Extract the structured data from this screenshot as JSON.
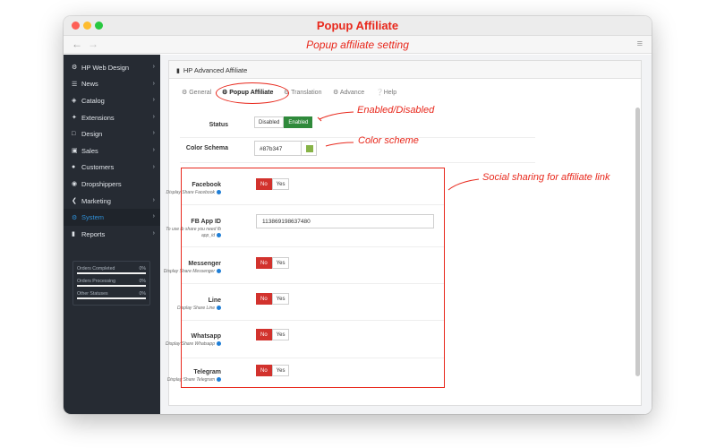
{
  "window": {
    "title": "Popup Affiliate",
    "subtitle": "Popup affiliate setting"
  },
  "browser": {
    "back_icon": "arrow-left-icon",
    "forward_icon": "arrow-right-icon",
    "menu_icon": "hamburger-icon"
  },
  "sidebar": {
    "items": [
      {
        "icon": "gears-icon",
        "label": "HP Web Design",
        "has_children": true
      },
      {
        "icon": "newspaper-icon",
        "label": "News",
        "has_children": true
      },
      {
        "icon": "tag-icon",
        "label": "Catalog",
        "has_children": true
      },
      {
        "icon": "puzzle-icon",
        "label": "Extensions",
        "has_children": true
      },
      {
        "icon": "monitor-icon",
        "label": "Design",
        "has_children": true
      },
      {
        "icon": "cart-icon",
        "label": "Sales",
        "has_children": true
      },
      {
        "icon": "user-icon",
        "label": "Customers",
        "has_children": true
      },
      {
        "icon": "users-icon",
        "label": "Dropshippers",
        "has_children": false
      },
      {
        "icon": "share-icon",
        "label": "Marketing",
        "has_children": true
      },
      {
        "icon": "gear-icon",
        "label": "System",
        "has_children": true,
        "active": true
      },
      {
        "icon": "bar-chart-icon",
        "label": "Reports",
        "has_children": true
      }
    ],
    "stats": [
      {
        "label": "Orders Completed",
        "percent": "0%"
      },
      {
        "label": "Orders Processing",
        "percent": "0%"
      },
      {
        "label": "Other Statuses",
        "percent": "0%"
      }
    ]
  },
  "panel": {
    "title": "HP Advanced Affiliate",
    "tabs": [
      {
        "label": "General",
        "icon": "gear-icon"
      },
      {
        "label": "Popup Affiliate",
        "icon": "gears-icon",
        "active": true
      },
      {
        "label": "Translation",
        "icon": "gears-icon"
      },
      {
        "label": "Advance",
        "icon": "gears-icon"
      },
      {
        "label": "Help",
        "icon": "question-circle-icon"
      }
    ]
  },
  "form": {
    "status": {
      "label": "Status",
      "off": "Disabled",
      "on": "Enabled",
      "value": "Enabled"
    },
    "color_schema": {
      "label": "Color Schema",
      "value": "#87b347",
      "swatch": "#87b347"
    },
    "facebook": {
      "label": "Facebook",
      "help": "Display Share Facebook",
      "no": "No",
      "yes": "Yes",
      "value": "No"
    },
    "fb_app_id": {
      "label": "FB App ID",
      "help": "To use fb share you need fb app_id",
      "value": "113869198637480"
    },
    "messenger": {
      "label": "Messenger",
      "help": "Display Share Messenger",
      "no": "No",
      "yes": "Yes",
      "value": "No"
    },
    "line": {
      "label": "Line",
      "help": "Display Share Line",
      "no": "No",
      "yes": "Yes",
      "value": "No"
    },
    "whatsapp": {
      "label": "Whatsapp",
      "help": "Display Share Whatsapp",
      "no": "No",
      "yes": "Yes",
      "value": "No"
    },
    "telegram": {
      "label": "Telegram",
      "help": "Display Share Telegram",
      "no": "No",
      "yes": "Yes",
      "value": "No"
    }
  },
  "annotations": {
    "status": "Enabled/Disabled",
    "color": "Color scheme",
    "social": "Social sharing for affiliate link"
  },
  "colors": {
    "accent": "#e8281c",
    "sidebar_bg": "#262b33",
    "enabled": "#2f8a3b",
    "no": "#d2322d",
    "active_menu": "#2f8fd6"
  }
}
